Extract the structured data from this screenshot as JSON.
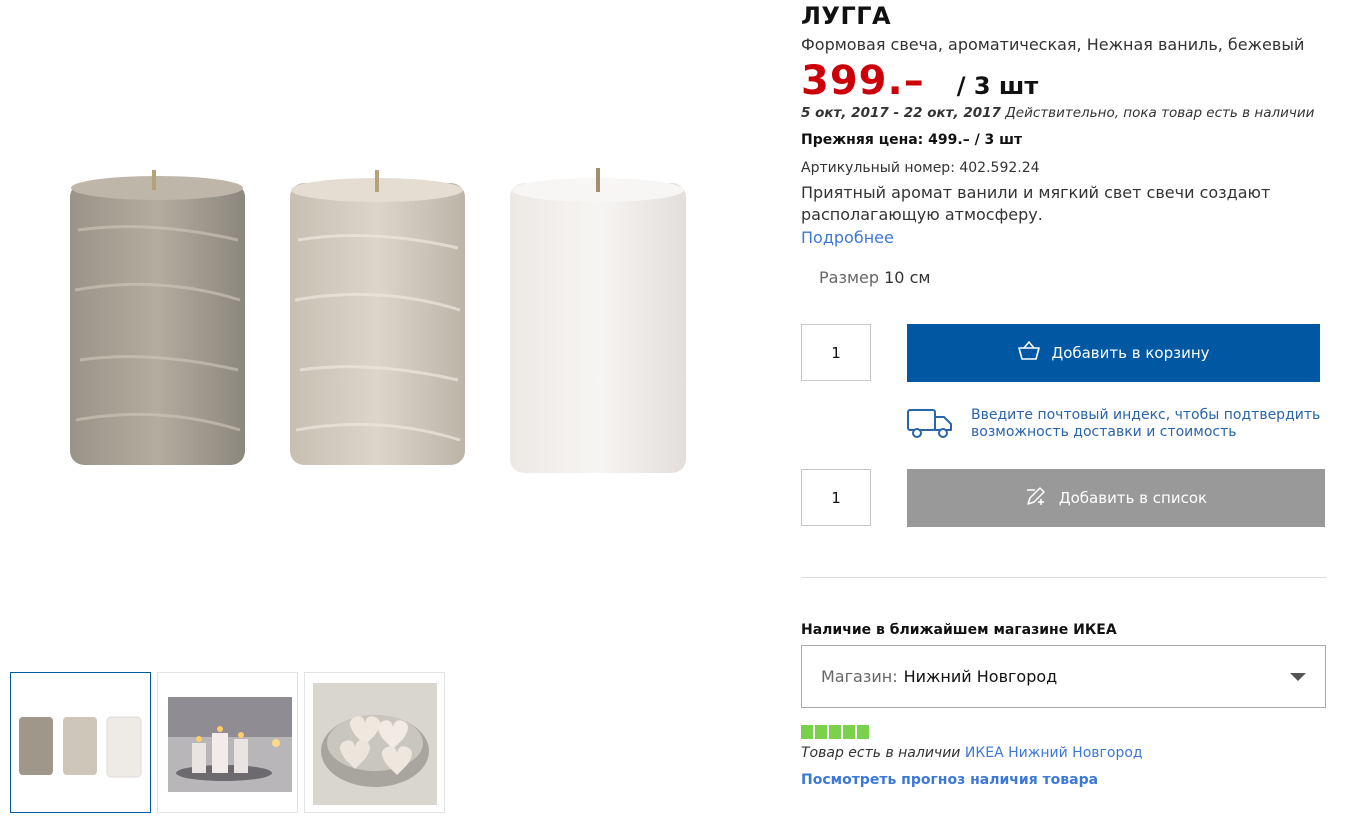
{
  "product": {
    "name": "ЛУГГА",
    "subtitle": "Формовая свеча, ароматическая, Нежная ваниль, бежевый",
    "price": "399.–",
    "unit": "/ 3 шт",
    "validity_dates": "5 окт, 2017 - 22 окт, 2017",
    "validity_note": "Действительно, пока товар есть в наличии",
    "old_price": "Прежняя цена: 499.– / 3 шт",
    "article": "Артикульный номер: 402.592.24",
    "description": "Приятный аромат ванили и мягкий свет свечи создают располагающую атмосферу.",
    "more_link": "Подробнее",
    "size_label": "Размер",
    "size_value": "10 см"
  },
  "cart": {
    "quantity": "1",
    "add_to_cart_label": "Добавить в корзину"
  },
  "delivery": {
    "text": "Введите почтовый индекс, чтобы подтвердить возможность доставки и стоимость"
  },
  "list": {
    "quantity": "1",
    "add_to_list_label": "Добавить в список"
  },
  "stock": {
    "heading": "Наличие в ближайшем магазине ИКЕА",
    "store_label": "Магазин:",
    "store_value": "Нижний Новгород",
    "level": 5,
    "status_text": "Товар есть в наличии",
    "status_store": "ИКЕА Нижний Новгород",
    "forecast_link": "Посмотреть прогноз наличия товара"
  },
  "colors": {
    "price_red": "#cc0008",
    "cart_blue": "#0058a3",
    "list_gray": "#999999",
    "link_blue": "#3c78d8",
    "stock_green": "#7ad14b"
  },
  "thumbnails": [
    {
      "name": "three-candles"
    },
    {
      "name": "lit-candles-on-tray"
    },
    {
      "name": "heart-candles-in-bowl"
    }
  ]
}
